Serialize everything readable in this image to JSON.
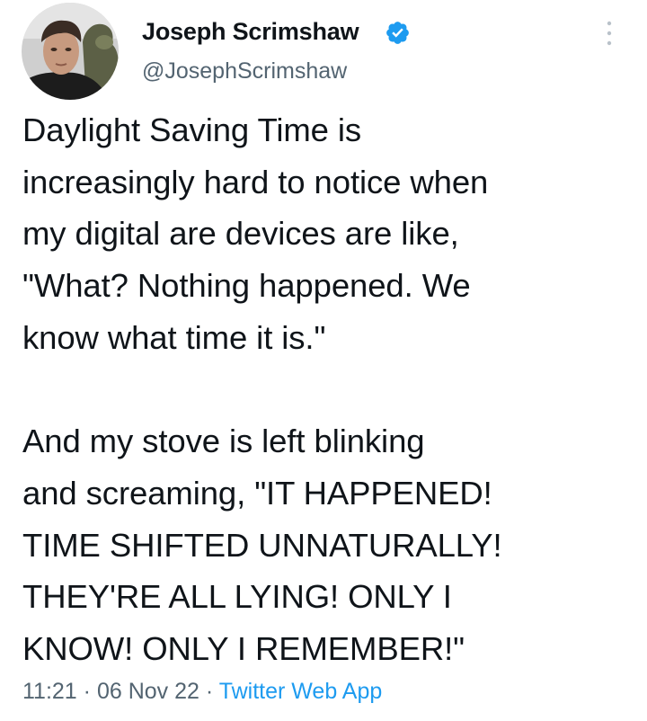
{
  "author": {
    "name": "Joseph Scrimshaw",
    "handle": "@JosephScrimshaw",
    "verified": true,
    "avatar_icon": "profile-photo",
    "verified_icon": "verified-badge-icon",
    "verified_color": "#1d9bf0"
  },
  "tweet": {
    "paragraphs": [
      "Daylight Saving Time is\nincreasingly hard to notice when\nmy digital are devices are like,\n\"What? Nothing happened. We\nknow what time it is.\"",
      "And my stove is left blinking\nand screaming, \"IT HAPPENED!\nTIME SHIFTED UNNATURALLY!\nTHEY'RE ALL LYING! ONLY I\nKNOW! ONLY I REMEMBER!\""
    ],
    "time": "11:21",
    "date": "06 Nov 22",
    "separator": "·",
    "source": "Twitter Web App"
  },
  "menu_icon": "more-vertical-icon",
  "colors": {
    "text": "#0f1419",
    "secondary": "#536471",
    "accent": "#1d9bf0"
  }
}
